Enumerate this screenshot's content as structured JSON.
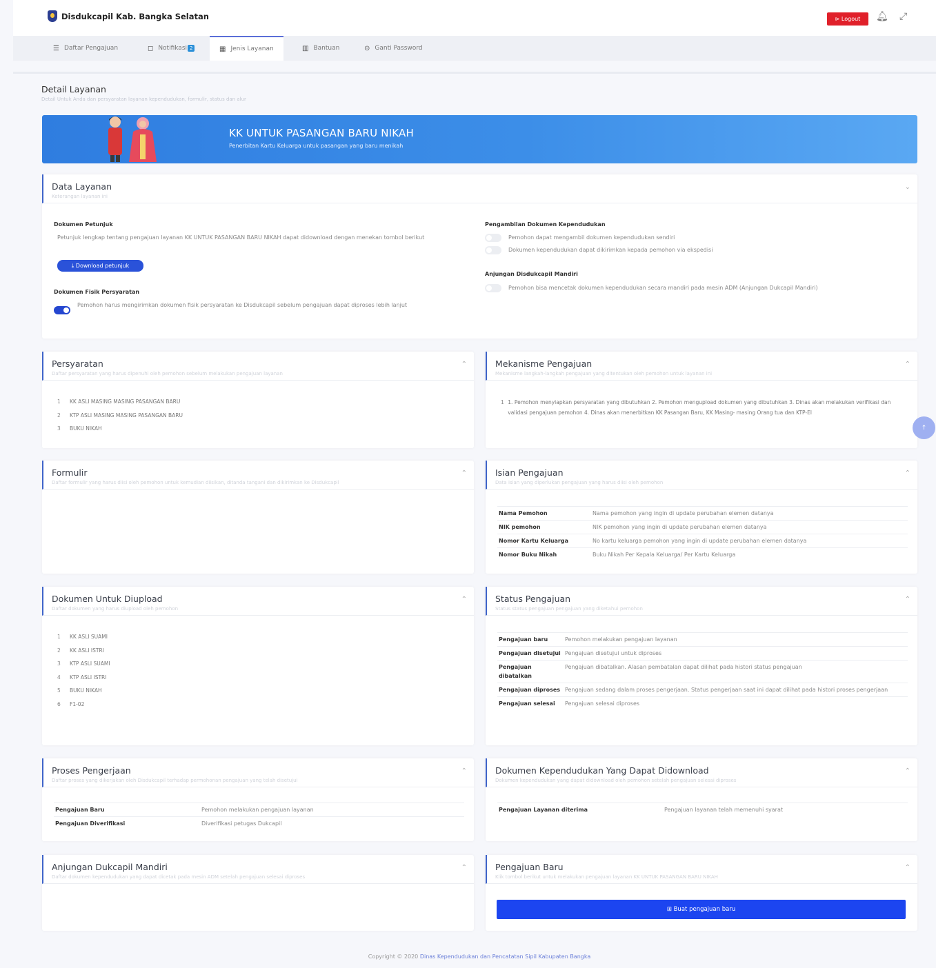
{
  "app": {
    "name": "Disdukcapil Kab. Bangka Selatan",
    "logout": "⊳ Logout"
  },
  "nav": [
    {
      "icon": "☰",
      "label": "Daftar Pengajuan"
    },
    {
      "icon": "◻",
      "label": "Notifikasi",
      "badge": "2"
    },
    {
      "icon": "▦",
      "label": "Jenis Layanan"
    },
    {
      "icon": "▥",
      "label": "Bantuan"
    },
    {
      "icon": "⊙",
      "label": "Ganti Password"
    }
  ],
  "page": {
    "title": "Detail Layanan",
    "subtitle": "Detail Untuk Anda dan persyaratan layanan kependudukan, formulir, status dan alur"
  },
  "banner": {
    "title": "KK UNTUK PASANGAN BARU NIKAH",
    "subtitle": "Penerbitan Kartu Keluarga untuk pasangan yang baru menikah"
  },
  "data_layanan": {
    "title": "Data Layanan",
    "subtitle": "Keterangan layanan ini",
    "petunjuk_label": "Dokumen Petunjuk",
    "petunjuk_text": "Petunjuk lengkap tentang pengajuan layanan KK UNTUK PASANGAN BARU NIKAH dapat didownload dengan menekan tombol berikut",
    "download_button": "⤓ Download petunjuk",
    "fisik_label": "Dokumen Fisik Persyaratan",
    "fisik_text": "Pemohon harus mengirimkan dokumen fisik persyaratan ke Disdukcapil sebelum pengajuan dapat diproses lebih lanjut",
    "fisik_on": true,
    "pengambilan_label": "Pengambilan Dokumen Kependudukan",
    "pengambilan_opt1": "Pemohon dapat mengambil dokumen kependudukan sendiri",
    "pengambilan_opt2": "Dokumen kependudukan dapat dikirimkan kepada pemohon via ekspedisi",
    "adm_label": "Anjungan Disdukcapil Mandiri",
    "adm_text": "Pemohon bisa mencetak dokumen kependudukan secara mandiri pada mesin ADM (Anjungan Dukcapil Mandiri)"
  },
  "persyaratan": {
    "title": "Persyaratan",
    "subtitle": "Daftar persyaratan yang harus dipenuhi oleh pemohon sebelum melakukan pengajuan layanan",
    "items": [
      "KK ASLI MASING MASING PASANGAN BARU",
      "KTP ASLI MASING MASING PASANGAN BARU",
      "BUKU NIKAH"
    ]
  },
  "mekanisme": {
    "title": "Mekanisme Pengajuan",
    "subtitle": "Mekanisme langkah-langkah pengajuan yang ditentukan oleh pemohon untuk layanan ini",
    "items": [
      "1. Pemohon menyiapkan persyaratan yang dibutuhkan 2. Pemohon mengupload dokumen yang dibutuhkan 3. Dinas akan melakukan verifikasi dan validasi pengajuan pemohon 4. Dinas akan menerbitkan KK Pasangan Baru, KK Masing- masing Orang tua dan KTP-El"
    ]
  },
  "formulir": {
    "title": "Formulir",
    "subtitle": "Daftar formulir yang harus diisi oleh pemohon untuk kemudian diisikan, ditanda tangani dan dikirimkan ke Disdukcapil"
  },
  "isian": {
    "title": "Isian Pengajuan",
    "subtitle": "Data isian yang diperlukan pengajuan yang harus diisi oleh pemohon",
    "rows": [
      {
        "k": "Nama Pemohon",
        "v": "Nama pemohon yang ingin di update perubahan elemen datanya"
      },
      {
        "k": "NIK pemohon",
        "v": "NIK pemohon yang ingin di update perubahan elemen datanya"
      },
      {
        "k": "Nomor Kartu Keluarga",
        "v": "No kartu keluarga pemohon yang ingin di update perubahan elemen datanya"
      },
      {
        "k": "Nomor Buku Nikah",
        "v": "Buku Nikah Per Kepala Keluarga/ Per Kartu Keluarga"
      }
    ]
  },
  "dokumen_upload": {
    "title": "Dokumen Untuk Diupload",
    "subtitle": "Daftar dokumen yang harus diupload oleh pemohon",
    "items": [
      "KK ASLI SUAMI",
      "KK ASLI ISTRI",
      "KTP ASLI SUAMI",
      "KTP ASLI ISTRI",
      "BUKU NIKAH",
      "F1-02"
    ]
  },
  "status": {
    "title": "Status Pengajuan",
    "subtitle": "Status status pengajuan pengajuan yang diketahui pemohon",
    "rows": [
      {
        "k": "Pengajuan baru",
        "v": "Pemohon melakukan pengajuan layanan"
      },
      {
        "k": "Pengajuan disetujui",
        "v": "Pengajuan disetujui untuk diproses"
      },
      {
        "k": "Pengajuan dibatalkan",
        "v": "Pengajuan dibatalkan. Alasan pembatalan dapat dilihat pada histori status pengajuan"
      },
      {
        "k": "Pengajuan diproses",
        "v": "Pengajuan sedang dalam proses pengerjaan. Status pengerjaan saat ini dapat dilihat pada histori proses pengerjaan"
      },
      {
        "k": "Pengajuan selesai",
        "v": "Pengajuan selesai diproses"
      }
    ]
  },
  "proses": {
    "title": "Proses Pengerjaan",
    "subtitle": "Daftar proses yang dikerjakan oleh Disdukcapil terhadap permohonan pengajuan yang telah disetujui",
    "rows": [
      {
        "k": "Pengajuan Baru",
        "v": "Pemohon melakukan pengajuan layanan"
      },
      {
        "k": "Pengajuan Diverifikasi",
        "v": "Diverifikasi petugas Dukcapil"
      }
    ]
  },
  "dokumen_download": {
    "title": "Dokumen Kependudukan Yang Dapat Didownload",
    "subtitle": "Dokumen kependudukan yang dapat didownload oleh pemohon setelah pengajuan selesai diproses",
    "rows": [
      {
        "k": "Pengajuan Layanan diterima",
        "v": "Pengajuan layanan telah memenuhi syarat"
      }
    ]
  },
  "anjungan": {
    "title": "Anjungan Dukcapil Mandiri",
    "subtitle": "Daftar dokumen kependudukan yang dapat dicetak pada mesin ADM setelah pengajuan selesai diproses"
  },
  "pengajuan_baru": {
    "title": "Pengajuan Baru",
    "subtitle": "Klik tombol berikut untuk melakukan pengajuan layanan KK UNTUK PASANGAN BARU NIKAH",
    "button": "⊞ Buat pengajuan baru"
  },
  "footer": {
    "prefix": "Copyright © 2020 ",
    "link": "Dinas Kependudukan dan Pencatatan Sipil Kabupaten Bangka"
  },
  "colors": {
    "primary": "#2a52d9",
    "accent": "#3e63c9",
    "danger": "#e0202a",
    "banner": "#2f7de0"
  }
}
